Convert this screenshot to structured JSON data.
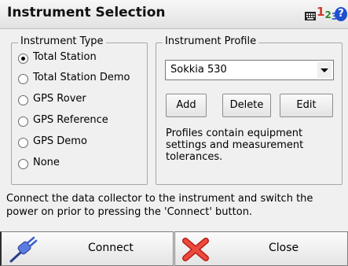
{
  "window": {
    "title": "Instrument Selection"
  },
  "titlebar_icons": {
    "keyboard": "keyboard-icon",
    "sip_digits": [
      "1",
      "2",
      "3"
    ],
    "help": "?"
  },
  "instrument_type": {
    "legend": "Instrument Type",
    "selected": "Total Station",
    "options": [
      "Total Station",
      "Total Station Demo",
      "GPS Rover",
      "GPS Reference",
      "GPS Demo",
      "None"
    ]
  },
  "instrument_profile": {
    "legend": "Instrument Profile",
    "selected_value": "Sokkia 530",
    "add_label": "Add",
    "delete_label": "Delete",
    "edit_label": "Edit",
    "note": "Profiles contain equipment settings and measurement tolerances."
  },
  "info": {
    "text": "Connect the data collector to the instrument and switch the power on prior to pressing the 'Connect' button."
  },
  "actions": {
    "connect_label": "Connect",
    "close_label": "Close"
  },
  "colors": {
    "help_blue": "#1e4fd0",
    "close_red": "#e0332a",
    "plug_blue": "#3a5fd0"
  }
}
